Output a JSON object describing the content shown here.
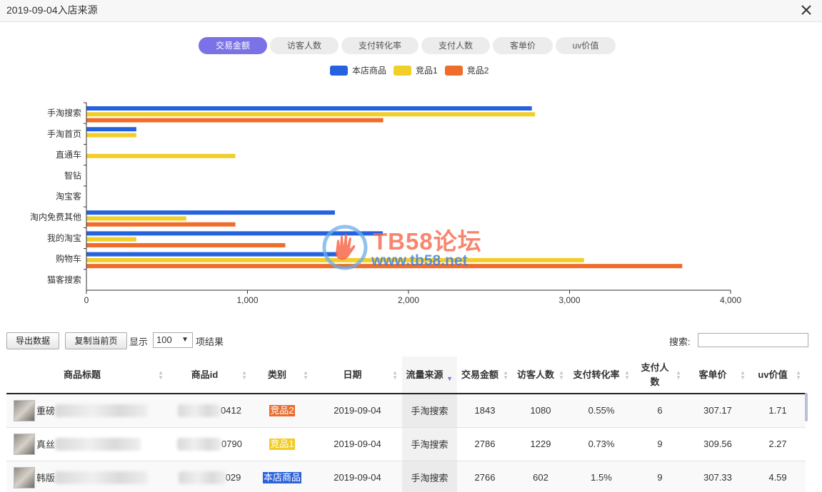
{
  "window": {
    "title": "2019-09-04入店来源"
  },
  "tabs": [
    {
      "label": "交易金额",
      "active": true
    },
    {
      "label": "访客人数",
      "active": false
    },
    {
      "label": "支付转化率",
      "active": false
    },
    {
      "label": "支付人数",
      "active": false
    },
    {
      "label": "客单价",
      "active": false
    },
    {
      "label": "uv价值",
      "active": false
    }
  ],
  "colors": {
    "own": "#2563de",
    "comp1": "#f2ce28",
    "comp2": "#ef6c2b",
    "tab_active": "#7c72e8"
  },
  "chart_data": {
    "type": "bar",
    "orientation": "horizontal",
    "categories": [
      "手淘搜索",
      "手淘首页",
      "直通车",
      "智钻",
      "淘宝客",
      "淘内免费其他",
      "我的淘宝",
      "购物车",
      "猫客搜索"
    ],
    "series": [
      {
        "name": "本店商品",
        "color": "#2563de",
        "values": [
          2766,
          310,
          0,
          0,
          0,
          1543,
          1840,
          1560,
          0
        ]
      },
      {
        "name": "竞品1",
        "color": "#f2ce28",
        "values": [
          2786,
          310,
          925,
          0,
          0,
          620,
          310,
          3090,
          0
        ]
      },
      {
        "name": "竞品2",
        "color": "#ef6c2b",
        "values": [
          1843,
          0,
          0,
          0,
          0,
          925,
          1235,
          3700,
          0
        ]
      }
    ],
    "xlim": [
      0,
      4000
    ],
    "xticks": [
      "0",
      "1,000",
      "2,000",
      "3,000",
      "4,000"
    ],
    "legend_position": "top-center",
    "grid": false
  },
  "watermark": {
    "title": "TB58论坛",
    "url": "www.tb58.net"
  },
  "toolbar": {
    "export_label": "导出数据",
    "copy_label": "复制当前页",
    "show_label": "显示",
    "page_size": "100",
    "result_label": "项结果",
    "search_label": "搜索:",
    "search_value": ""
  },
  "table": {
    "headers": {
      "title": "商品标题",
      "id": "商品id",
      "type": "类别",
      "date": "日期",
      "source": "流量来源",
      "amount": "交易金额",
      "visitors": "访客人数",
      "conv": "支付转化率",
      "buyers": "支付人数",
      "aov": "客单价",
      "uv": "uv价值"
    },
    "rows": [
      {
        "title": "重磅",
        "id": "0412",
        "type": "竞品2",
        "type_class": "c2",
        "date": "2019-09-04",
        "source": "手淘搜索",
        "amount": "1843",
        "visitors": "1080",
        "conv": "0.55%",
        "buyers": "6",
        "aov": "307.17",
        "uv": "1.71"
      },
      {
        "title": "真丝",
        "id": "0790",
        "type": "竞品1",
        "type_class": "c1",
        "date": "2019-09-04",
        "source": "手淘搜索",
        "amount": "2786",
        "visitors": "1229",
        "conv": "0.73%",
        "buyers": "9",
        "aov": "309.56",
        "uv": "2.27"
      },
      {
        "title": "韩版",
        "id": "029",
        "type": "本店商品",
        "type_class": "own",
        "date": "2019-09-04",
        "source": "手淘搜索",
        "amount": "2766",
        "visitors": "602",
        "conv": "1.5%",
        "buyers": "9",
        "aov": "307.33",
        "uv": "4.59"
      }
    ]
  }
}
